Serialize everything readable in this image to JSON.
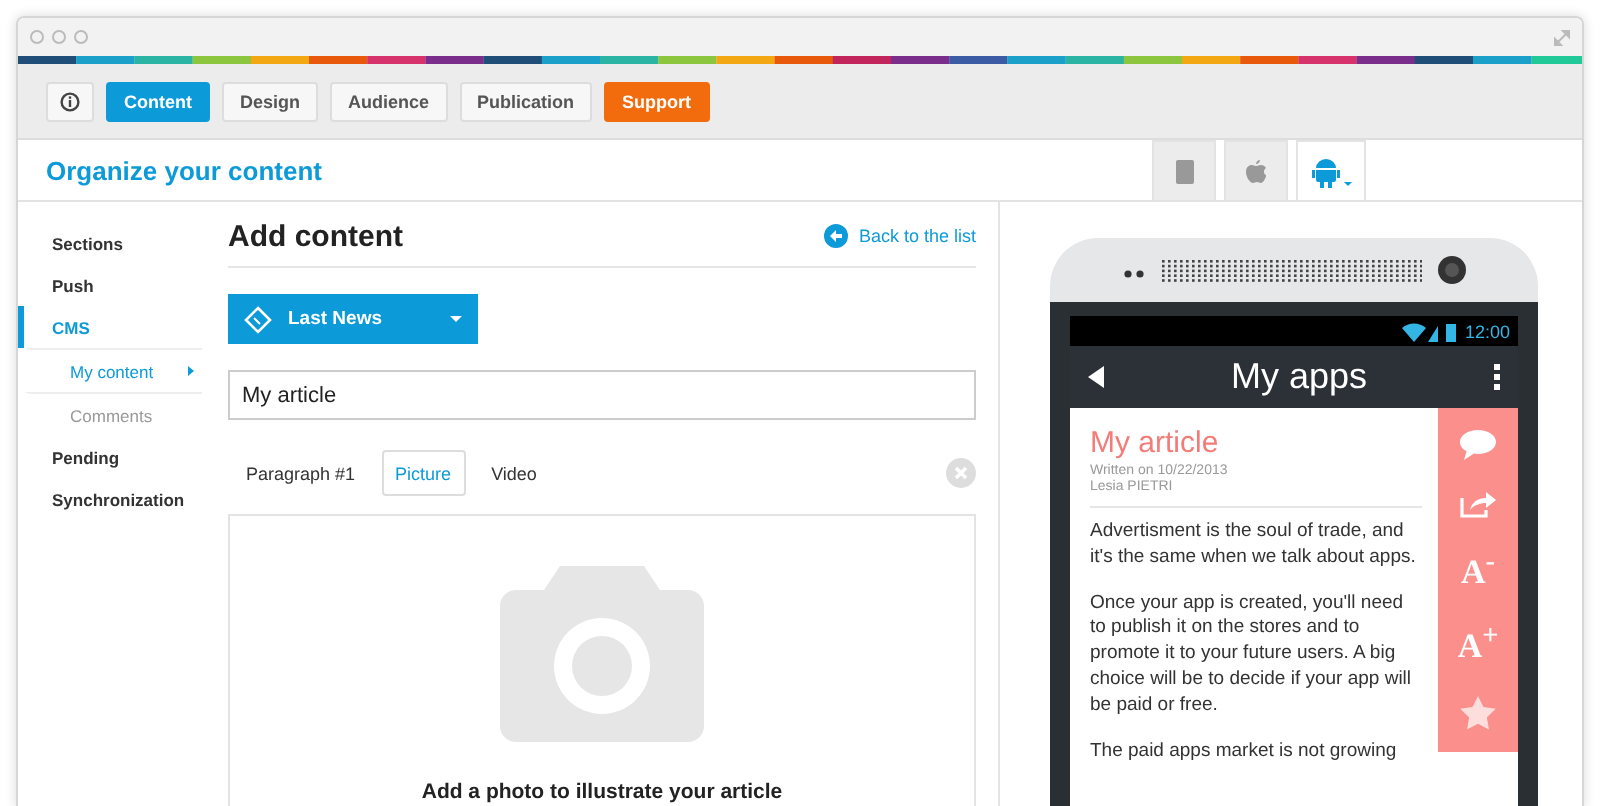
{
  "toolbar": {
    "tabs": [
      {
        "kind": "icon",
        "selected": false
      },
      {
        "kind": "tab",
        "label": "Content",
        "selected": true
      },
      {
        "kind": "tab",
        "label": "Design",
        "selected": false
      },
      {
        "kind": "tab",
        "label": "Audience",
        "selected": false
      },
      {
        "kind": "tab",
        "label": "Publication",
        "selected": false
      },
      {
        "kind": "accent",
        "label": "Support",
        "selected": false
      }
    ]
  },
  "header": {
    "title": "Organize your content",
    "platforms": [
      {
        "selected": false
      },
      {
        "selected": false
      },
      {
        "selected": true
      }
    ]
  },
  "sidebar": {
    "items": [
      {
        "label": "Sections",
        "selected": false
      },
      {
        "label": "Push",
        "selected": false
      },
      {
        "label": "CMS",
        "selected": true,
        "children": [
          {
            "label": "My content",
            "selected": true
          },
          {
            "label": "Comments",
            "selected": false
          }
        ]
      },
      {
        "label": "Pending",
        "selected": false
      },
      {
        "label": "Synchronization",
        "selected": false
      }
    ]
  },
  "editor": {
    "title": "Add content",
    "back_link": "Back to the list",
    "category": "Last News",
    "title_field": {
      "value": "My article"
    },
    "content_tabs": [
      {
        "label": "Paragraph #1",
        "selected": false
      },
      {
        "label": "Picture",
        "selected": true
      },
      {
        "label": "Video",
        "selected": false
      }
    ],
    "dropzone": "Add a photo to illustrate your article"
  },
  "preview": {
    "time": "12:00",
    "app_title": "My apps",
    "article": {
      "title": "My article",
      "date": "Written on 10/22/2013",
      "author": "Lesia PIETRI",
      "paragraphs": [
        "Advertisment is the soul of trade, and it's the same when we talk about apps.",
        "Once your app is created, you'll need to publish it on the stores and to promote it to your future users. A big choice will be to decide if your app will be paid or free.",
        "The paid apps market is not growing"
      ]
    },
    "actions": [
      {
        "kind": "comment"
      },
      {
        "kind": "share"
      },
      {
        "kind": "text",
        "label": "A$^{-}$"
      },
      {
        "kind": "text",
        "label": "A$^{+}$"
      },
      {
        "kind": "star"
      }
    ]
  }
}
